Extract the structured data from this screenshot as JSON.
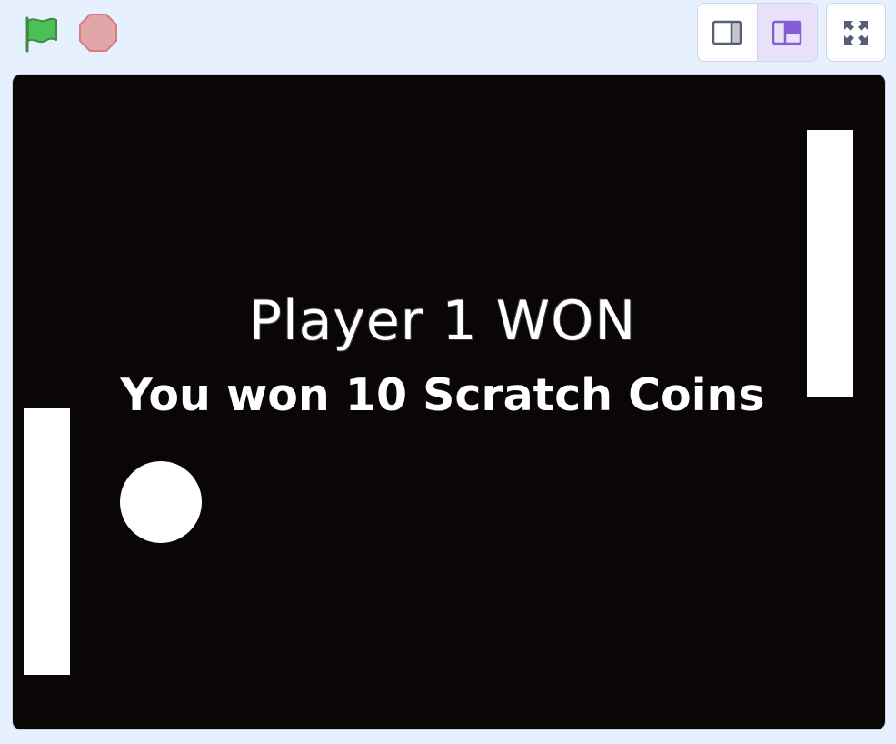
{
  "toolbar": {
    "green_flag_icon": "green-flag-icon",
    "stop_icon": "stop-sign-icon",
    "small_stage_icon": "small-stage-layout-icon",
    "large_stage_icon": "large-stage-layout-icon",
    "fullscreen_icon": "fullscreen-icon",
    "active_layout": "large-stage"
  },
  "stage": {
    "title": "Player 1 WON",
    "subtitle": "You won 10 Scratch Coins"
  },
  "colors": {
    "background": "#e6f0ff",
    "stage": "#0b0606",
    "sprites": "#ffffff",
    "flag": "#4cbf56",
    "stop": "#e2a5a8",
    "accent": "#855cd6"
  }
}
